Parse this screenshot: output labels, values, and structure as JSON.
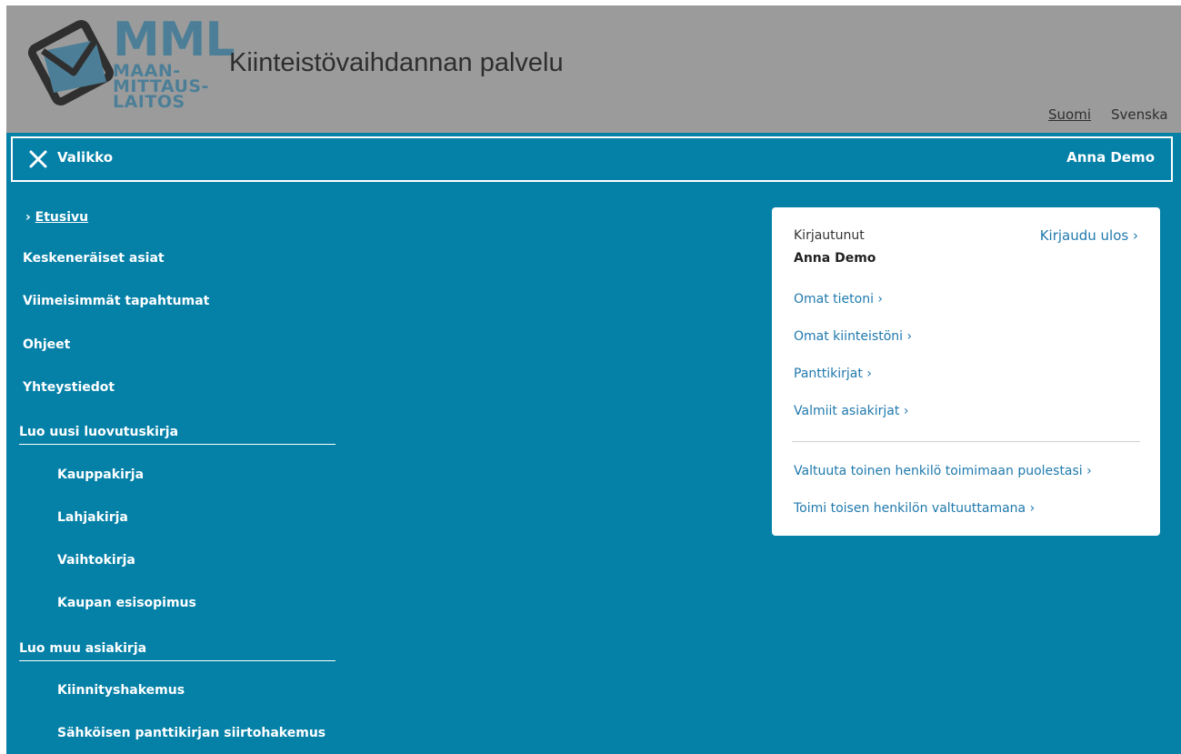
{
  "header": {
    "logo_title": "MML",
    "logo_line1": "MAAN-",
    "logo_line2": "MITTAUS-",
    "logo_line3": "LAITOS",
    "app_title": "Kiinteistövaihdannan palvelu",
    "languages": [
      "Suomi",
      "Svenska"
    ]
  },
  "menubar": {
    "close_icon": "close-icon",
    "label": "Valikko",
    "user": "Anna Demo"
  },
  "nav": {
    "home": "Etusivu",
    "items": [
      "Keskeneräiset asiat",
      "Viimeisimmät tapahtumat",
      "Ohjeet",
      "Yhteystiedot"
    ],
    "section1": {
      "title": "Luo uusi luovutuskirja",
      "items": [
        "Kauppakirja",
        "Lahjakirja",
        "Vaihtokirja",
        "Kaupan esisopimus"
      ]
    },
    "section2": {
      "title": "Luo muu asiakirja",
      "items": [
        "Kiinnityshakemus",
        "Sähköisen panttikirjan siirtohakemus"
      ]
    }
  },
  "panel": {
    "logged_in_label": "Kirjautunut",
    "user_name": "Anna Demo",
    "logout": "Kirjaudu ulos ›",
    "links": [
      "Omat tietoni ›",
      "Omat kiinteistöni ›",
      "Panttikirjat ›",
      "Valmiit asiakirjat ›"
    ],
    "links2": [
      "Valtuuta toinen henkilö toimimaan puolestasi ›",
      "Toimi toisen henkilön valtuuttamana ›"
    ]
  },
  "colors": {
    "primary": "#0581a8",
    "header_bg": "#9b9b9b",
    "logo": "#4c7f97",
    "link": "#1f79ad"
  }
}
